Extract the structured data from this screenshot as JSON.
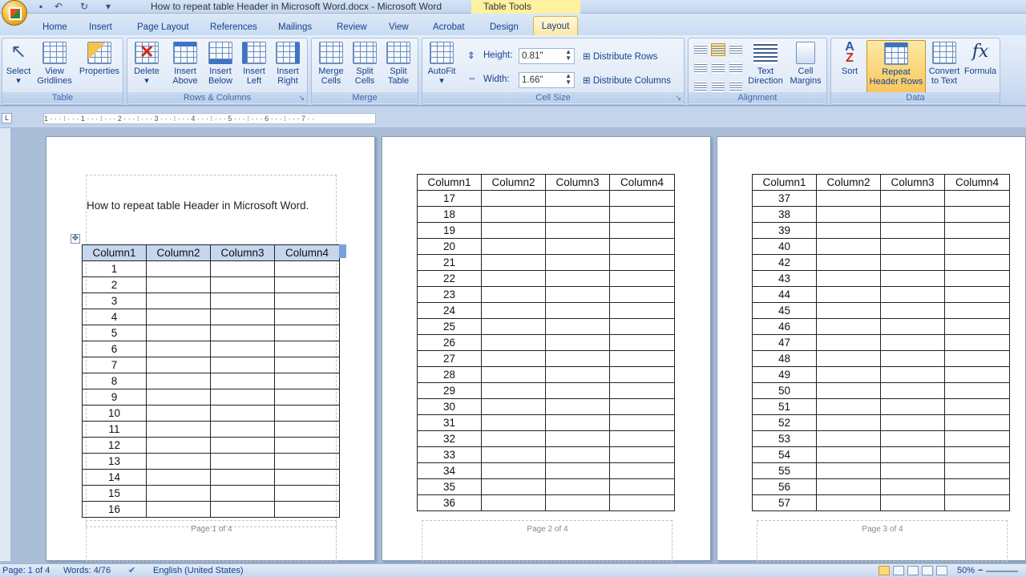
{
  "window": {
    "title": "How to repeat table Header in Microsoft Word.docx - Microsoft Word",
    "context_title": "Table Tools"
  },
  "tabs": {
    "home": "Home",
    "insert": "Insert",
    "page_layout": "Page Layout",
    "references": "References",
    "mailings": "Mailings",
    "review": "Review",
    "view": "View",
    "acrobat": "Acrobat",
    "design": "Design",
    "layout": "Layout"
  },
  "ribbon": {
    "table": {
      "label": "Table",
      "select": "Select",
      "view_gridlines_1": "View",
      "view_gridlines_2": "Gridlines",
      "properties": "Properties"
    },
    "rows_columns": {
      "label": "Rows & Columns",
      "delete": "Delete",
      "insert_above_1": "Insert",
      "insert_above_2": "Above",
      "insert_below_1": "Insert",
      "insert_below_2": "Below",
      "insert_left_1": "Insert",
      "insert_left_2": "Left",
      "insert_right_1": "Insert",
      "insert_right_2": "Right"
    },
    "merge": {
      "label": "Merge",
      "merge_cells_1": "Merge",
      "merge_cells_2": "Cells",
      "split_cells_1": "Split",
      "split_cells_2": "Cells",
      "split_table_1": "Split",
      "split_table_2": "Table"
    },
    "cell_size": {
      "label": "Cell Size",
      "autofit": "AutoFit",
      "height_label": "Height:",
      "height_value": "0.81\"",
      "width_label": "Width:",
      "width_value": "1.66\"",
      "distribute_rows": "Distribute Rows",
      "distribute_columns": "Distribute Columns"
    },
    "alignment": {
      "label": "Alignment",
      "text_direction_1": "Text",
      "text_direction_2": "Direction",
      "cell_margins_1": "Cell",
      "cell_margins_2": "Margins"
    },
    "data": {
      "label": "Data",
      "sort": "Sort",
      "repeat_header_1": "Repeat",
      "repeat_header_2": "Header Rows",
      "convert_1": "Convert",
      "convert_2": "to Text",
      "formula": "Formula"
    }
  },
  "ruler": {
    "marks": "1 · · · ⁝ · · · 1 · · · ⁝ · · · 2 · · · ⁝ · · · 3 · · · ⁝ · · · 4 · · · ⁝ · · · 5 · · · ⁝ · · · 6 · · · ⁝ · · · 7 · ·",
    "tab_selector": "L"
  },
  "document": {
    "heading": "How to repeat table Header in Microsoft Word.",
    "headers": [
      "Column1",
      "Column2",
      "Column3",
      "Column4"
    ],
    "page1_rows": [
      "1",
      "2",
      "3",
      "4",
      "5",
      "6",
      "7",
      "8",
      "9",
      "10",
      "11",
      "12",
      "13",
      "14",
      "15",
      "16"
    ],
    "page2_rows": [
      "17",
      "18",
      "19",
      "20",
      "21",
      "22",
      "23",
      "24",
      "25",
      "26",
      "27",
      "28",
      "29",
      "30",
      "31",
      "32",
      "33",
      "34",
      "35",
      "36"
    ],
    "page3_rows": [
      "37",
      "38",
      "39",
      "40",
      "42",
      "43",
      "44",
      "45",
      "46",
      "47",
      "48",
      "49",
      "50",
      "51",
      "52",
      "53",
      "54",
      "55",
      "56",
      "57"
    ],
    "page_labels": [
      "Page 1 of 4",
      "Page 2 of 4",
      "Page 3 of 4"
    ]
  },
  "status": {
    "page": "Page: 1 of 4",
    "words": "Words: 4/76",
    "language": "English (United States)",
    "zoom": "50%"
  }
}
